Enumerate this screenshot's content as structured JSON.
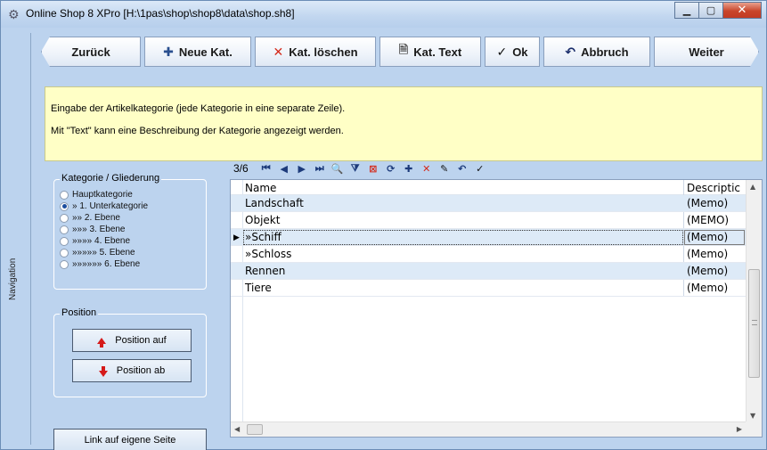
{
  "window": {
    "title": "Online Shop 8 XPro [H:\\1pas\\shop\\shop8\\data\\shop.sh8]",
    "min_glyph": "▁",
    "max_glyph": "▢",
    "close_glyph": "✕"
  },
  "navigation": {
    "label": "Navigation"
  },
  "toolbar": {
    "back": "Zurück",
    "new_cat": "Neue Kat.",
    "delete_cat": "Kat. löschen",
    "cat_text": "Kat. Text",
    "ok": "Ok",
    "cancel": "Abbruch",
    "next": "Weiter"
  },
  "info": {
    "line1": "Eingabe der Artikelkategorie (jede Kategorie in eine separate Zeile).",
    "line2": "Mit \"Text\" kann eine Beschreibung der Kategorie angezeigt werden."
  },
  "levels": {
    "title": "Kategorie / Gliederung",
    "options": [
      {
        "label": "Hauptkategorie",
        "selected": false
      },
      {
        "label": "» 1. Unterkategorie",
        "selected": true
      },
      {
        "label": "»» 2. Ebene",
        "selected": false
      },
      {
        "label": "»»» 3. Ebene",
        "selected": false
      },
      {
        "label": "»»»» 4. Ebene",
        "selected": false
      },
      {
        "label": "»»»»» 5. Ebene",
        "selected": false
      },
      {
        "label": "»»»»»» 6. Ebene",
        "selected": false
      }
    ]
  },
  "position": {
    "title": "Position",
    "up": "Position auf",
    "down": "Position ab"
  },
  "link_button": "Link auf eigene Seite",
  "grid_nav": {
    "record": "3/6",
    "icons": [
      "first-icon",
      "prior-icon",
      "next-icon",
      "last-icon",
      "find-icon",
      "filter-icon",
      "clear-filter-icon",
      "refresh-icon",
      "insert-icon",
      "delete-icon",
      "edit-icon",
      "cancel-icon",
      "post-icon"
    ]
  },
  "grid": {
    "columns": {
      "name": "Name",
      "description": "Descriptic"
    },
    "rows": [
      {
        "name": "Landschaft",
        "description": "(Memo)",
        "current": false
      },
      {
        "name": "Objekt",
        "description": "(MEMO)",
        "current": false
      },
      {
        "name": " »Schiff",
        "description": "(Memo)",
        "current": true
      },
      {
        "name": " »Schloss",
        "description": "(Memo)",
        "current": false
      },
      {
        "name": "Rennen",
        "description": "(Memo)",
        "current": false
      },
      {
        "name": "Tiere",
        "description": "(Memo)",
        "current": false
      }
    ]
  },
  "colors": {
    "window_bg": "#bcd3ee",
    "info_bg": "#ffffc6",
    "row_alt": "#ddeaf7",
    "close_red": "#c9462b"
  }
}
